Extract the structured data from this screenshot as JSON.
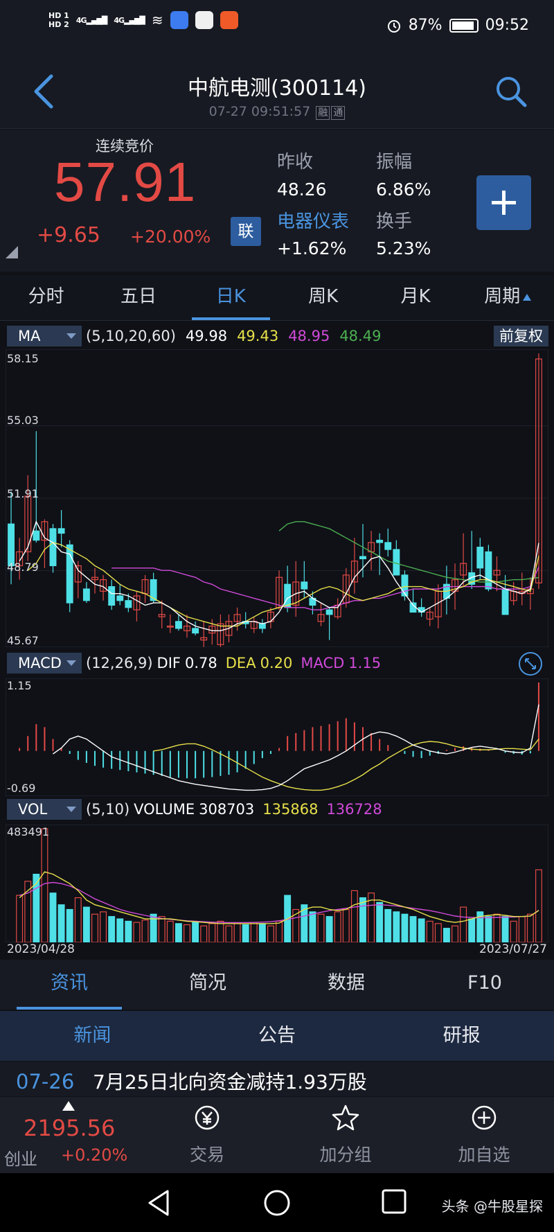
{
  "status_bar": {
    "hd1": "HD 1",
    "hd2": "HD 2",
    "signal1": "4G",
    "signal2": "4G",
    "battery_pct": "87%",
    "time": "09:52"
  },
  "header": {
    "title": "中航电测(300114)",
    "timestamp": "07-27 09:51:57",
    "tag1": "融",
    "tag2": "通"
  },
  "quote": {
    "mode_label": "连续竞价",
    "price": "57.91",
    "change": "+9.65",
    "change_pct": "+20.00%",
    "badge": "联",
    "prev_close_label": "昨收",
    "prev_close": "48.26",
    "amplitude_label": "振幅",
    "amplitude": "6.86%",
    "sector_label": "电器仪表",
    "sector_change": "+1.62%",
    "turnover_label": "换手",
    "turnover": "5.23%"
  },
  "period_tabs": [
    "分时",
    "五日",
    "日K",
    "周K",
    "月K",
    "周期"
  ],
  "active_period": "日K",
  "ma_row": {
    "button": "MA",
    "params": "(5,10,20,60)",
    "ma5": "49.98",
    "ma10": "49.43",
    "ma20": "48.95",
    "ma60": "48.49",
    "adjust": "前复权"
  },
  "macd_row": {
    "button": "MACD",
    "params": "(12,26,9)",
    "dif_label": "DIF",
    "dif": "0.78",
    "dea_label": "DEA",
    "dea": "0.20",
    "macd_label": "MACD",
    "macd": "1.15"
  },
  "vol_row": {
    "button": "VOL",
    "params": "(5,10)",
    "volume_label": "VOLUME",
    "volume": "308703",
    "ma5": "135868",
    "ma10": "136728"
  },
  "chart_data": {
    "type": "candlestick",
    "price_axis": [
      "58.15",
      "55.03",
      "51.91",
      "48.79",
      "45.67"
    ],
    "price_range": [
      45.67,
      58.15
    ],
    "macd_axis": [
      "1.15",
      "-0.69"
    ],
    "macd_range": [
      -0.69,
      1.15
    ],
    "vol_axis_max": "483491",
    "vol_range": [
      0,
      483491
    ],
    "x_start": "2023/04/28",
    "x_end": "2023/07/27",
    "colors": {
      "up": "#e34a45",
      "down": "#4ee0e6",
      "ma5": "#ffffff",
      "ma10": "#e8e04a",
      "ma20": "#d04ad8",
      "ma60": "#4caf50"
    },
    "candles": [
      [
        50.8,
        52.2,
        48.2,
        49.0
      ],
      [
        49.0,
        50.2,
        48.4,
        49.6
      ],
      [
        49.6,
        52.9,
        49.2,
        52.0
      ],
      [
        50.5,
        54.8,
        50.0,
        50.1
      ],
      [
        50.1,
        51.0,
        48.9,
        50.9
      ],
      [
        50.6,
        50.8,
        48.7,
        49.0
      ],
      [
        50.6,
        51.4,
        49.8,
        50.4
      ],
      [
        49.9,
        50.1,
        47.0,
        47.4
      ],
      [
        48.3,
        49.2,
        47.6,
        49.0
      ],
      [
        48.0,
        48.3,
        47.4,
        47.5
      ],
      [
        48.4,
        48.9,
        47.8,
        48.5
      ],
      [
        47.9,
        48.6,
        47.5,
        48.4
      ],
      [
        48.1,
        48.4,
        47.1,
        47.3
      ],
      [
        47.7,
        48.2,
        47.3,
        47.5
      ],
      [
        47.5,
        47.8,
        47.0,
        47.2
      ],
      [
        47.1,
        47.9,
        46.6,
        47.7
      ],
      [
        47.8,
        48.6,
        47.4,
        48.4
      ],
      [
        48.4,
        48.7,
        47.4,
        47.5
      ],
      [
        46.8,
        47.5,
        46.3,
        46.9
      ],
      [
        46.4,
        46.9,
        46.1,
        46.4
      ],
      [
        46.6,
        46.9,
        46.2,
        46.3
      ],
      [
        46.2,
        46.9,
        45.9,
        46.4
      ],
      [
        46.3,
        46.6,
        46.0,
        46.1
      ],
      [
        45.8,
        46.6,
        45.5,
        45.9
      ],
      [
        46.1,
        46.7,
        45.6,
        46.4
      ],
      [
        45.6,
        46.9,
        45.5,
        46.5
      ],
      [
        46.0,
        46.9,
        45.7,
        46.6
      ],
      [
        46.6,
        47.2,
        46.2,
        46.9
      ],
      [
        46.6,
        47.0,
        46.3,
        46.5
      ],
      [
        46.3,
        46.8,
        46.1,
        46.6
      ],
      [
        46.5,
        46.7,
        46.1,
        46.3
      ],
      [
        46.6,
        47.2,
        46.3,
        47.0
      ],
      [
        47.2,
        48.8,
        47.1,
        48.5
      ],
      [
        48.2,
        49.0,
        47.0,
        47.2
      ],
      [
        47.3,
        49.2,
        46.8,
        48.3
      ],
      [
        48.3,
        49.2,
        47.6,
        48.0
      ],
      [
        47.6,
        47.9,
        46.9,
        47.3
      ],
      [
        46.6,
        47.4,
        46.4,
        46.9
      ],
      [
        47.1,
        47.2,
        45.8,
        46.9
      ],
      [
        46.8,
        47.6,
        46.7,
        47.3
      ],
      [
        47.4,
        48.9,
        47.2,
        48.6
      ],
      [
        48.3,
        50.2,
        47.8,
        49.2
      ],
      [
        49.4,
        50.8,
        48.5,
        49.3
      ],
      [
        49.6,
        50.5,
        48.8,
        50.0
      ],
      [
        50.1,
        50.4,
        48.6,
        50.0
      ],
      [
        50.0,
        50.6,
        49.4,
        49.7
      ],
      [
        49.7,
        50.1,
        48.6,
        48.6
      ],
      [
        48.6,
        48.8,
        47.5,
        47.7
      ],
      [
        47.4,
        48.0,
        47.0,
        47.0
      ],
      [
        47.2,
        47.6,
        46.8,
        47.0
      ],
      [
        46.7,
        47.2,
        46.4,
        47.0
      ],
      [
        46.8,
        48.2,
        46.3,
        47.9
      ],
      [
        48.2,
        49.0,
        46.9,
        47.6
      ],
      [
        47.9,
        49.1,
        47.1,
        48.4
      ],
      [
        48.6,
        50.4,
        48.1,
        49.1
      ],
      [
        48.7,
        50.5,
        48.0,
        48.2
      ],
      [
        49.8,
        50.2,
        48.4,
        48.9
      ],
      [
        49.6,
        49.9,
        47.9,
        48.0
      ],
      [
        48.6,
        49.4,
        47.9,
        48.8
      ],
      [
        48.0,
        48.6,
        46.9,
        46.9
      ],
      [
        47.5,
        48.3,
        47.3,
        47.9
      ],
      [
        47.8,
        48.7,
        47.3,
        47.9
      ],
      [
        47.8,
        48.5,
        47.1,
        48.0
      ],
      [
        48.26,
        58.15,
        48.0,
        57.91
      ]
    ],
    "ma5": [
      49.2,
      49.8,
      50.9,
      50.2,
      50.0,
      49.6,
      49.5,
      48.8,
      48.5,
      48.2,
      48.1,
      47.8,
      47.8,
      47.7,
      47.5,
      47.3,
      47.4,
      47.4,
      47.2,
      46.9,
      46.6,
      46.4,
      46.3,
      46.2,
      46.2,
      46.3,
      46.5,
      46.6,
      46.6,
      46.5,
      46.6,
      47.0,
      47.6,
      47.8,
      47.9,
      47.6,
      47.4,
      47.2,
      47.2,
      47.8,
      48.5,
      48.9,
      49.3,
      49.4,
      48.9,
      48.3,
      47.8,
      47.3,
      47.0,
      47.2,
      47.4,
      47.6,
      47.9,
      48.3,
      48.5,
      48.6,
      48.4,
      48.2,
      48.0,
      47.9,
      47.8,
      48.0,
      49.98
    ],
    "ma10": [
      48.8,
      49.1,
      49.7,
      50.0,
      49.9,
      49.7,
      49.5,
      49.3,
      49.0,
      48.8,
      48.5,
      48.2,
      48.0,
      47.9,
      47.8,
      47.6,
      47.4,
      47.2,
      47.0,
      46.8,
      46.7,
      46.6,
      46.5,
      46.4,
      46.4,
      46.4,
      46.6,
      46.8,
      47.0,
      47.1,
      47.2,
      47.3,
      47.4,
      47.6,
      47.8,
      48.0,
      48.1,
      48.0,
      47.8,
      47.6,
      47.5,
      47.6,
      47.7,
      47.8,
      48.0,
      48.1,
      48.1,
      48.1,
      48.0,
      47.9,
      47.9,
      48.0,
      48.1,
      48.3,
      48.4,
      48.4,
      48.3,
      48.2,
      48.1,
      48.0,
      47.9,
      49.43
    ],
    "ma20": [
      48.9,
      48.9,
      48.9,
      48.9,
      48.9,
      48.9,
      48.8,
      48.8,
      48.7,
      48.6,
      48.5,
      48.3,
      48.2,
      48.0,
      47.9,
      47.8,
      47.7,
      47.6,
      47.5,
      47.4,
      47.3,
      47.2,
      47.2,
      47.2,
      47.1,
      47.1,
      47.2,
      47.3,
      47.4,
      47.5,
      47.5,
      47.6,
      47.6,
      47.7,
      47.8,
      47.9,
      48.0,
      48.0,
      48.0,
      48.0,
      48.1,
      48.1,
      48.1,
      48.1,
      48.1,
      48.1,
      48.0,
      48.0,
      48.0,
      48.0,
      48.1,
      48.95
    ],
    "ma60": [
      50.5,
      50.8,
      50.9,
      50.9,
      50.8,
      50.7,
      50.6,
      50.4,
      50.2,
      50.0,
      49.8,
      49.6,
      49.4,
      49.2,
      49.1,
      49.0,
      48.9,
      48.8,
      48.7,
      48.6,
      48.5,
      48.45,
      48.4,
      48.35,
      48.3,
      48.3,
      48.3,
      48.35,
      48.4,
      48.4,
      48.45,
      48.49
    ],
    "macd_hist": [
      0.05,
      0.25,
      0.45,
      0.4,
      0.2,
      0.05,
      -0.05,
      -0.15,
      -0.2,
      -0.25,
      -0.28,
      -0.3,
      -0.32,
      -0.34,
      -0.36,
      -0.38,
      -0.4,
      -0.42,
      -0.44,
      -0.45,
      -0.46,
      -0.46,
      -0.45,
      -0.44,
      -0.42,
      -0.4,
      -0.36,
      -0.3,
      -0.22,
      -0.12,
      -0.05,
      0.05,
      0.25,
      0.3,
      0.35,
      0.4,
      0.42,
      0.45,
      0.5,
      0.55,
      0.48,
      0.4,
      0.3,
      0.2,
      0.1,
      0.0,
      -0.05,
      -0.1,
      -0.12,
      -0.08,
      -0.05,
      0.02,
      0.05,
      0.08,
      0.06,
      0.04,
      0.02,
      0.0,
      -0.03,
      -0.05,
      -0.06,
      -0.04,
      1.15
    ],
    "macd_dif": [
      -0.05,
      0.05,
      0.2,
      0.25,
      0.2,
      0.1,
      0.0,
      -0.1,
      -0.15,
      -0.2,
      -0.25,
      -0.3,
      -0.35,
      -0.4,
      -0.45,
      -0.5,
      -0.53,
      -0.56,
      -0.58,
      -0.6,
      -0.62,
      -0.64,
      -0.65,
      -0.66,
      -0.66,
      -0.65,
      -0.63,
      -0.58,
      -0.5,
      -0.4,
      -0.3,
      -0.25,
      -0.2,
      -0.15,
      -0.08,
      0.0,
      0.1,
      0.2,
      0.28,
      0.32,
      0.3,
      0.25,
      0.18,
      0.1,
      0.05,
      0.0,
      -0.03,
      -0.05,
      -0.02,
      0.02,
      0.06,
      0.08,
      0.06,
      0.04,
      0.0,
      -0.02,
      -0.03,
      0.05,
      0.78
    ],
    "macd_dea": [
      0.0,
      0.02,
      0.06,
      0.1,
      0.12,
      0.12,
      0.08,
      0.02,
      -0.05,
      -0.12,
      -0.2,
      -0.28,
      -0.36,
      -0.44,
      -0.5,
      -0.55,
      -0.6,
      -0.63,
      -0.65,
      -0.66,
      -0.66,
      -0.64,
      -0.6,
      -0.55,
      -0.48,
      -0.4,
      -0.3,
      -0.22,
      -0.12,
      -0.04,
      0.04,
      0.1,
      0.14,
      0.16,
      0.15,
      0.12,
      0.08,
      0.05,
      0.03,
      0.02,
      0.02,
      0.03,
      0.04,
      0.04,
      0.03,
      0.02,
      0.2
    ],
    "volume": [
      200000,
      260000,
      290000,
      483491,
      210000,
      160000,
      140000,
      190000,
      150000,
      120000,
      130000,
      110000,
      100000,
      90000,
      85000,
      95000,
      120000,
      110000,
      90000,
      80000,
      75000,
      85000,
      70000,
      80000,
      90000,
      70000,
      80000,
      75000,
      85000,
      80000,
      70000,
      90000,
      200000,
      140000,
      160000,
      130000,
      120000,
      110000,
      130000,
      140000,
      220000,
      190000,
      210000,
      170000,
      140000,
      130000,
      120000,
      110000,
      100000,
      90000,
      80000,
      60000,
      70000,
      150000,
      100000,
      130000,
      110000,
      120000,
      110000,
      90000,
      110000,
      120000,
      308703
    ],
    "vol_ma5": [
      190000,
      220000,
      250000,
      300000,
      290000,
      270000,
      250000,
      220000,
      180000,
      160000,
      150000,
      140000,
      130000,
      120000,
      110000,
      100000,
      100000,
      100000,
      100000,
      95000,
      90000,
      88000,
      85000,
      82000,
      80000,
      80000,
      80000,
      80000,
      80000,
      80000,
      80000,
      82000,
      100000,
      120000,
      140000,
      150000,
      150000,
      140000,
      135000,
      140000,
      160000,
      170000,
      180000,
      180000,
      170000,
      160000,
      150000,
      140000,
      125000,
      110000,
      100000,
      90000,
      85000,
      90000,
      100000,
      110000,
      115000,
      118000,
      115000,
      110000,
      110000,
      112000,
      135868
    ],
    "vol_ma10": [
      200000,
      210000,
      230000,
      250000,
      255000,
      250000,
      240000,
      225000,
      205000,
      185000,
      170000,
      155000,
      140000,
      130000,
      122000,
      115000,
      108000,
      102000,
      98000,
      95000,
      92000,
      90000,
      88000,
      86000,
      85000,
      84000,
      84000,
      84000,
      85000,
      86000,
      88000,
      92000,
      98000,
      105000,
      112000,
      120000,
      128000,
      135000,
      140000,
      145000,
      150000,
      155000,
      158000,
      160000,
      158000,
      155000,
      150000,
      145000,
      140000,
      135000,
      128000,
      120000,
      112000,
      108000,
      106000,
      105000,
      105000,
      106000,
      107000,
      108000,
      110000,
      112000,
      136728
    ]
  },
  "info_tabs": [
    "资讯",
    "简况",
    "数据",
    "F10"
  ],
  "active_info_tab": "资讯",
  "sub_tabs": [
    "新闻",
    "公告",
    "研报"
  ],
  "active_sub_tab": "新闻",
  "news": {
    "date": "07-26",
    "title": "7月25日北向资金减持1.93万股"
  },
  "toolbar": {
    "index_value": "2195.56",
    "index_name": "创业",
    "index_change": "+0.20%",
    "trade": "交易",
    "add_group": "加分组",
    "add_watch": "加自选"
  },
  "watermark": "头条 @牛股星探"
}
